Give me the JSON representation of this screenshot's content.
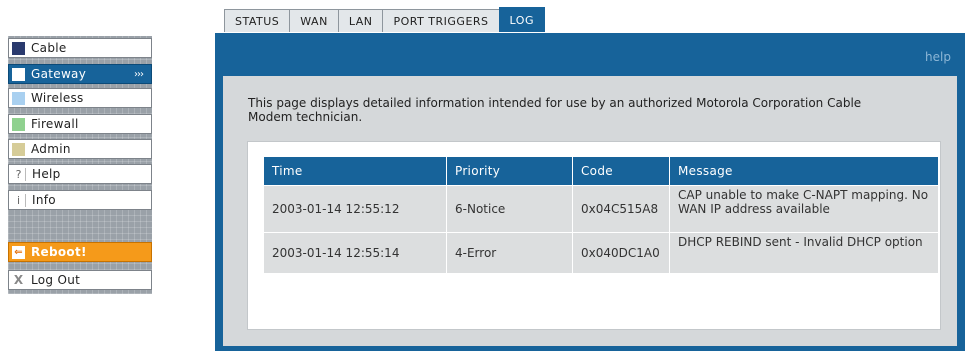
{
  "nav": {
    "items": [
      {
        "label": "Cable",
        "icon": "square-navy-icon",
        "color": "#2a3a6e"
      },
      {
        "label": "Gateway",
        "icon": "square-white-icon",
        "arrows": "›››",
        "active": true
      },
      {
        "label": "Wireless",
        "icon": "square-lightblue-icon",
        "color": "#a9d0f0"
      },
      {
        "label": "Firewall",
        "icon": "square-green-icon",
        "color": "#8fd18f"
      },
      {
        "label": "Admin",
        "icon": "square-tan-icon",
        "color": "#d6cc98"
      },
      {
        "label": "Help",
        "icon": "question-icon",
        "glyph": "?"
      },
      {
        "label": "Info",
        "icon": "info-icon",
        "glyph": "i"
      },
      {
        "label": "Reboot!",
        "icon": "reboot-arrow-icon",
        "glyph": "⇐"
      },
      {
        "label": "Log Out",
        "icon": "x-icon",
        "glyph": "X"
      }
    ]
  },
  "tabs": [
    "STATUS",
    "WAN",
    "LAN",
    "PORT TRIGGERS",
    "LOG"
  ],
  "active_tab": "LOG",
  "panel": {
    "help_link": "help",
    "description": "This page displays detailed information intended for use by an authorized Motorola Corporation Cable Modem technician."
  },
  "log": {
    "columns": [
      "Time",
      "Priority",
      "Code",
      "Message"
    ],
    "rows": [
      {
        "time": "2003-01-14 12:55:12",
        "priority": "6-Notice",
        "code": "0x04C515A8",
        "message": "CAP unable to make C-NAPT mapping. No WAN IP address available"
      },
      {
        "time": "2003-01-14 12:55:14",
        "priority": "4-Error",
        "code": "0x040DC1A0",
        "message": "DHCP REBIND sent - Invalid DHCP option"
      }
    ]
  },
  "colors": {
    "accent_blue": "#17639a",
    "reboot_orange": "#f59a1a",
    "panel_gray": "#d5d8da"
  }
}
